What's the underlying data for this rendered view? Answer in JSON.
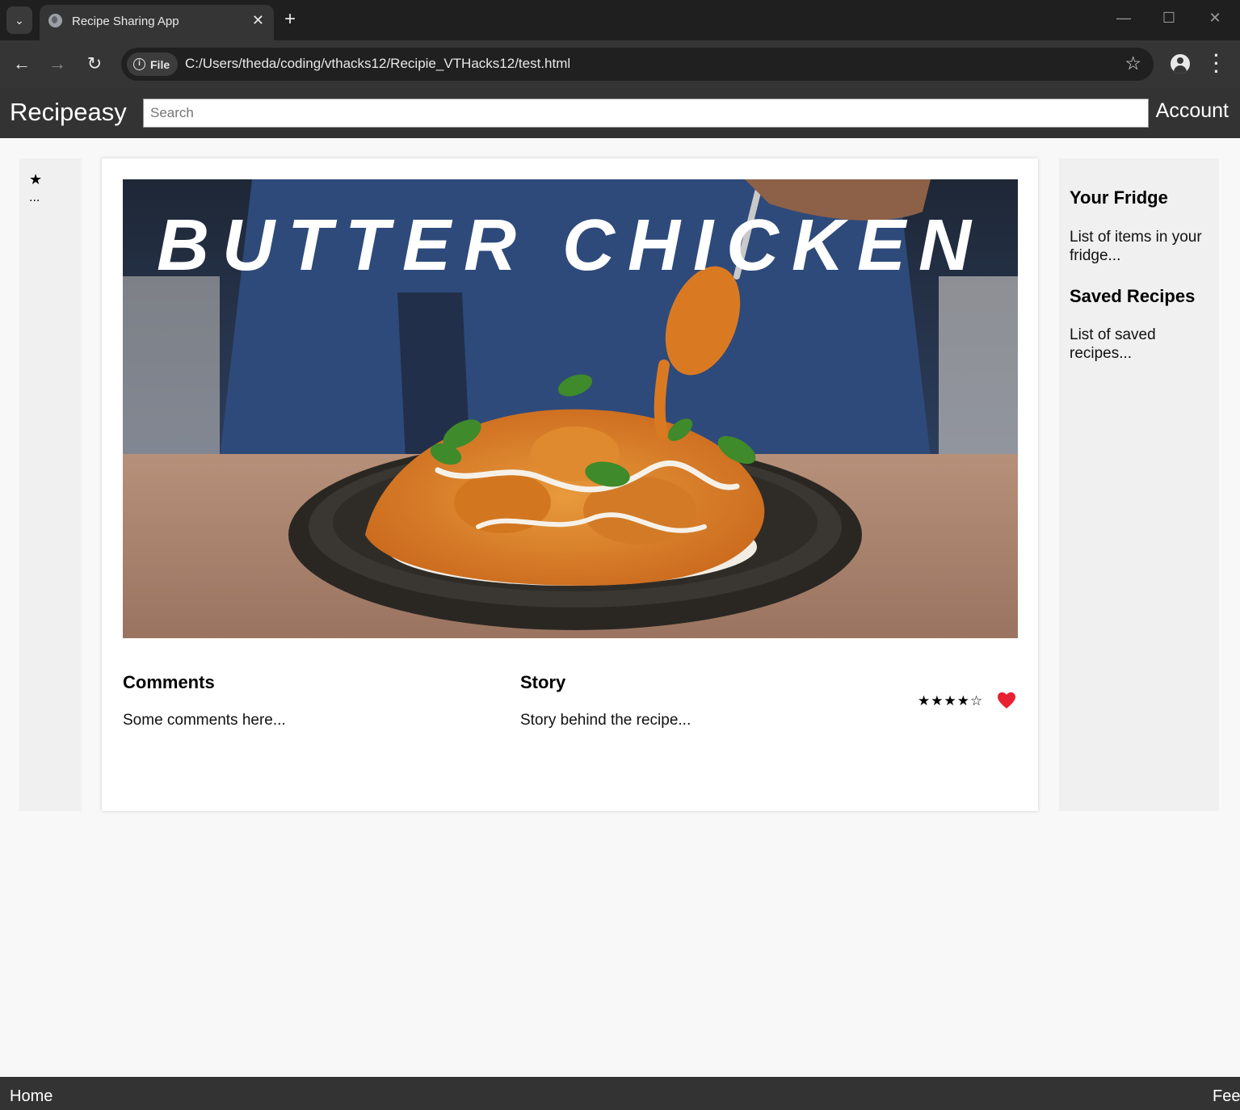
{
  "browser": {
    "tab_title": "Recipe Sharing App",
    "site_chip": "File",
    "url": "C:/Users/theda/coding/vthacks12/Recipie_VTHacks12/test.html",
    "icons": {
      "tab_menu": "chevron-down-icon",
      "favicon": "globe-icon",
      "tab_close": "close-icon",
      "new_tab": "plus-icon",
      "minimize": "minimize-icon",
      "maximize": "maximize-icon",
      "close_window": "close-icon",
      "back": "arrow-left-icon",
      "forward": "arrow-right-icon",
      "reload": "reload-icon",
      "site_info": "info-icon",
      "bookmark": "star-outline-icon",
      "profile": "person-icon",
      "menu": "kebab-icon"
    }
  },
  "header": {
    "brand": "Recipeasy",
    "search_placeholder": "Search",
    "account": "Account"
  },
  "left_rail": {
    "favorite_glyph": "★",
    "more_glyph": "..."
  },
  "post": {
    "hero_title": "BUTTER CHICKEN",
    "comments_title": "Comments",
    "comments_text": "Some comments here...",
    "story_title": "Story",
    "story_text": "Story behind the recipe...",
    "rating_display": "★★★★☆",
    "rating": 4,
    "rating_max": 5,
    "like_icon": "heart-icon",
    "like_color": "#e8202f"
  },
  "sidebar": {
    "fridge_title": "Your Fridge",
    "fridge_text": "List of items in your fridge...",
    "saved_title": "Saved Recipes",
    "saved_text": "List of saved recipes..."
  },
  "footer": {
    "home": "Home",
    "feed": "Fee"
  },
  "colors": {
    "header_bg": "#333333",
    "page_bg": "#f8f8f8",
    "panel_bg": "#f0f0f0"
  }
}
